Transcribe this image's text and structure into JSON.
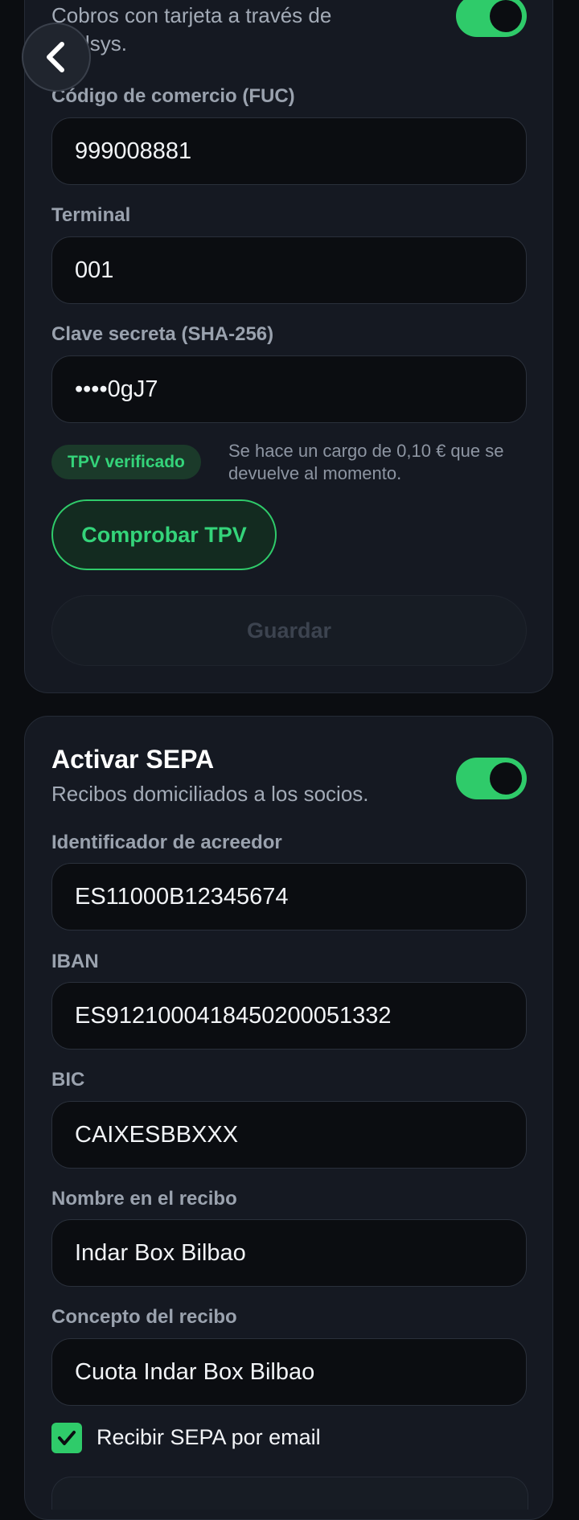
{
  "nav": {
    "back_icon": "chevron-left-icon"
  },
  "tpv": {
    "subtitle": "Cobros con tarjeta a través de Redsys.",
    "toggle_on": true,
    "fields": {
      "fuc": {
        "label": "Código de comercio (FUC)",
        "value": "999008881"
      },
      "terminal": {
        "label": "Terminal",
        "value": "001"
      },
      "secret": {
        "label": "Clave secreta (SHA-256)",
        "value": "••••0gJ7"
      }
    },
    "status_badge": "TPV verificado",
    "hint": "Se hace un cargo de 0,10 € que se devuelve al momento.",
    "check_button": "Comprobar TPV",
    "save_button": "Guardar"
  },
  "sepa": {
    "title": "Activar SEPA",
    "subtitle": "Recibos domiciliados a los socios.",
    "toggle_on": true,
    "fields": {
      "creditor_id": {
        "label": "Identificador de acreedor",
        "value": "ES11000B12345674"
      },
      "iban": {
        "label": "IBAN",
        "value": "ES9121000418450200051332"
      },
      "bic": {
        "label": "BIC",
        "value": "CAIXESBBXXX"
      },
      "receipt_name": {
        "label": "Nombre en el recibo",
        "value": "Indar Box Bilbao"
      },
      "receipt_concept": {
        "label": "Concepto del recibo",
        "value": "Cuota Indar Box Bilbao"
      }
    },
    "email_checkbox": {
      "label": "Recibir SEPA por email",
      "checked": true
    }
  },
  "colors": {
    "background": "#0b0d11",
    "card": "#151922",
    "accent": "#2fcb6a",
    "muted_text": "#9aa2ae"
  }
}
